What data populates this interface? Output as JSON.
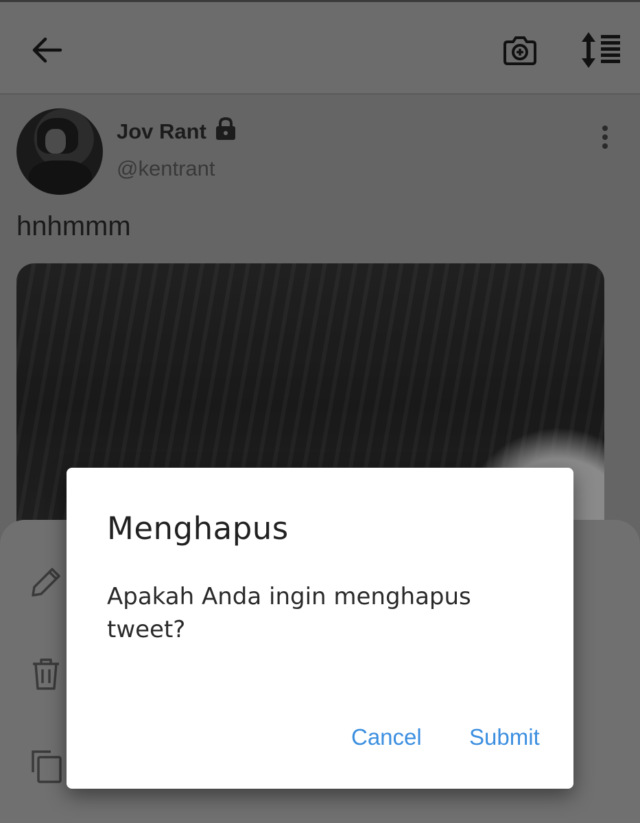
{
  "header": {
    "back_icon": "back-arrow-icon",
    "camera_icon": "add-photo-camera-icon",
    "sort_icon": "sort-list-icon"
  },
  "tweet": {
    "author_name": "Jov Rant",
    "author_locked_icon": "lock-icon",
    "author_handle": "@kentrant",
    "text": "hnhmmm",
    "more_icon": "more-vertical-icon"
  },
  "sheet": {
    "icons": [
      "edit-pencil-icon",
      "trash-icon",
      "copy-icon"
    ]
  },
  "dialog": {
    "title": "Menghapus",
    "message": "Apakah Anda ingin menghapus tweet?",
    "cancel_label": "Cancel",
    "submit_label": "Submit"
  },
  "colors": {
    "accent": "#3c8fe0",
    "dialog_bg": "#ffffff",
    "scrim": "#656565"
  }
}
